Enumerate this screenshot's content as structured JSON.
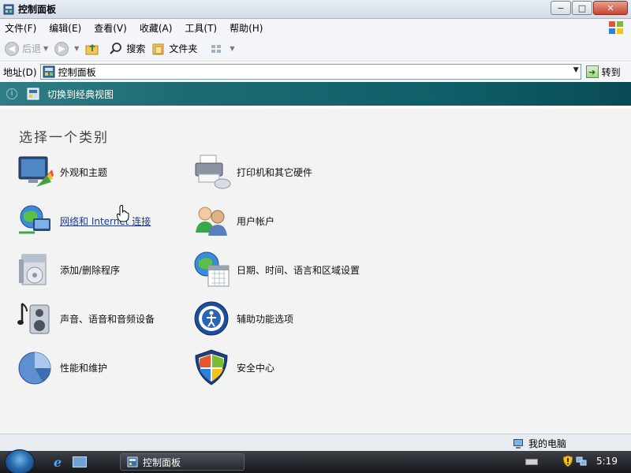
{
  "window": {
    "title": "控制面板",
    "minimize_glyph": "−",
    "maximize_glyph": "□",
    "close_glyph": "✕"
  },
  "menu": {
    "items": [
      "文件(F)",
      "编辑(E)",
      "查看(V)",
      "收藏(A)",
      "工具(T)",
      "帮助(H)"
    ]
  },
  "toolbar": {
    "back_label": "后退",
    "search_label": "搜索",
    "folders_label": "文件夹"
  },
  "address": {
    "label": "地址(D)",
    "value": "控制面板",
    "go_label": "转到"
  },
  "switch_view": {
    "label": "切换到经典视图"
  },
  "main": {
    "heading": "选择一个类别",
    "categories": [
      {
        "label": "外观和主题",
        "icon": "appearance-themes-icon"
      },
      {
        "label": "网络和 Internet 连接",
        "icon": "network-internet-icon"
      },
      {
        "label": "添加/删除程序",
        "icon": "add-remove-programs-icon"
      },
      {
        "label": "声音、语音和音频设备",
        "icon": "sounds-audio-icon"
      },
      {
        "label": "性能和维护",
        "icon": "performance-maintenance-icon"
      },
      {
        "label": "打印机和其它硬件",
        "icon": "printers-hardware-icon"
      },
      {
        "label": "用户帐户",
        "icon": "user-accounts-icon"
      },
      {
        "label": "日期、时间、语言和区域设置",
        "icon": "date-time-region-icon"
      },
      {
        "label": "辅助功能选项",
        "icon": "accessibility-icon"
      },
      {
        "label": "安全中心",
        "icon": "security-center-icon"
      }
    ]
  },
  "status": {
    "computer_label": "我的电脑"
  },
  "taskbar": {
    "task_label": "控制面板",
    "clock": "5:19"
  },
  "colors": {
    "switch_bar": "#0f5f68",
    "content_bg": "#f3f3f3",
    "link_hover": "#1d3a8f"
  }
}
